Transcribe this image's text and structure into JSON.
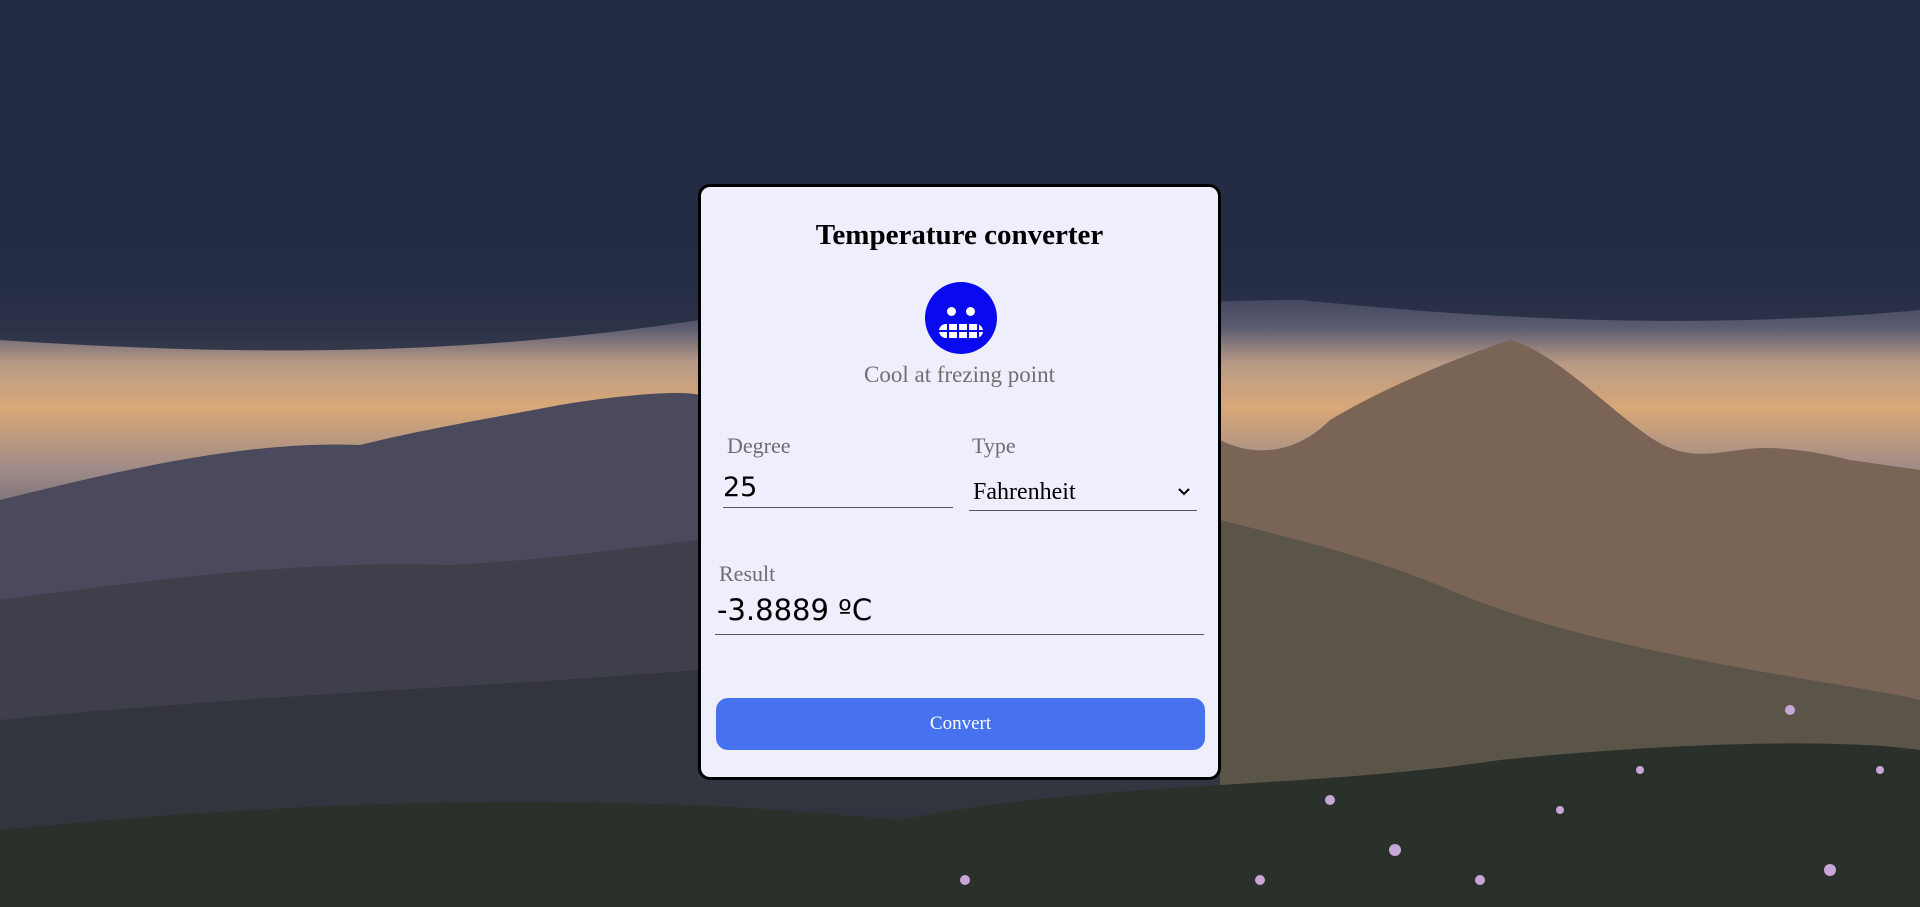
{
  "app": {
    "title": "Temperature converter",
    "status_text": "Cool at frezing point",
    "status_icon": "grimace-face-icon"
  },
  "form": {
    "degree_label": "Degree",
    "degree_value": "25",
    "type_label": "Type",
    "type_selected": "Fahrenheit",
    "result_label": "Result",
    "result_value": "-3.8889 ºC",
    "convert_label": "Convert"
  },
  "colors": {
    "card_bg": "#eeeefc",
    "face": "#0a0af0",
    "button": "#4672f0"
  }
}
